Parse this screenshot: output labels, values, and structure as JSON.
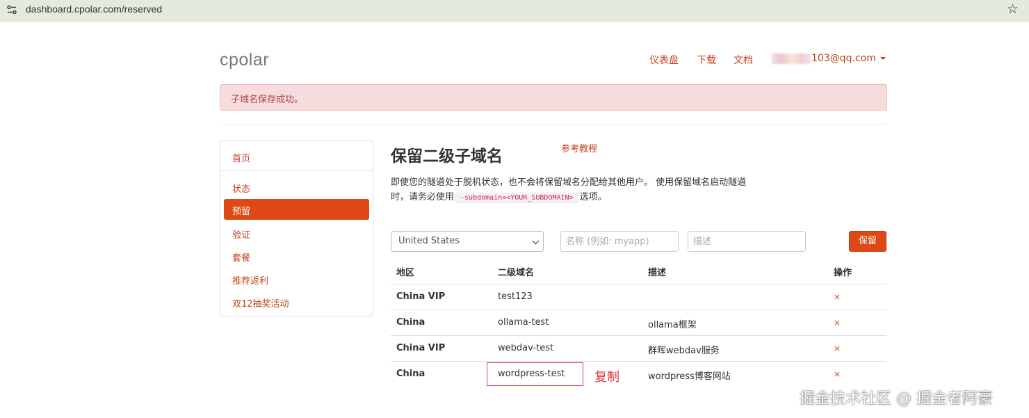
{
  "browser": {
    "url": "dashboard.cpolar.com/reserved",
    "icons": {
      "site_info": "tune-icon",
      "bookmark": "star-icon"
    }
  },
  "header": {
    "brand": "cpolar",
    "nav": [
      "仪表盘",
      "下载",
      "文档"
    ],
    "user_email": "103@qq.com"
  },
  "alert": {
    "message": "子域名保存成功。"
  },
  "sidebar": {
    "items": [
      {
        "label": "首页"
      },
      {
        "label": "状态"
      },
      {
        "label": "预留",
        "active": true
      },
      {
        "label": "验证"
      },
      {
        "label": "套餐"
      },
      {
        "label": "推荐返利"
      },
      {
        "label": "双12抽奖活动"
      }
    ]
  },
  "main": {
    "title": "保留二级子域名",
    "tutorial_link": "参考教程",
    "description_line1": "即使您的隧道处于脱机状态，也不会将保留域名分配给其他用户。 使用保留域名启动隧道",
    "description_line2_prefix": "时，请务必使用",
    "description_code": "-subdomain=<YOUR_SUBDOMAIN>",
    "description_line2_suffix": "选项。"
  },
  "form": {
    "region_selected": "United States",
    "name_placeholder": "名称 (例如: myapp)",
    "desc_placeholder": "描述",
    "save_label": "保留"
  },
  "table": {
    "headers": [
      "地区",
      "二级域名",
      "描述",
      "操作"
    ],
    "rows": [
      {
        "region": "China VIP",
        "subdomain": "test123",
        "description": "",
        "action": "×"
      },
      {
        "region": "China",
        "subdomain": "ollama-test",
        "description": "ollama框架",
        "action": "×"
      },
      {
        "region": "China VIP",
        "subdomain": "webdav-test",
        "description": "群晖webdav服务",
        "action": "×"
      },
      {
        "region": "China",
        "subdomain": "wordpress-test",
        "description": "wordpress博客网站",
        "action": "×"
      }
    ]
  },
  "annotation": {
    "copy_label": "复制"
  },
  "watermark": "掘金技术社区 @ 掘金者阿豪",
  "colors": {
    "accent": "#dd4814",
    "link": "#c0431d",
    "alert_bg": "#f6dcdc",
    "annotation": "#d83b3b"
  }
}
